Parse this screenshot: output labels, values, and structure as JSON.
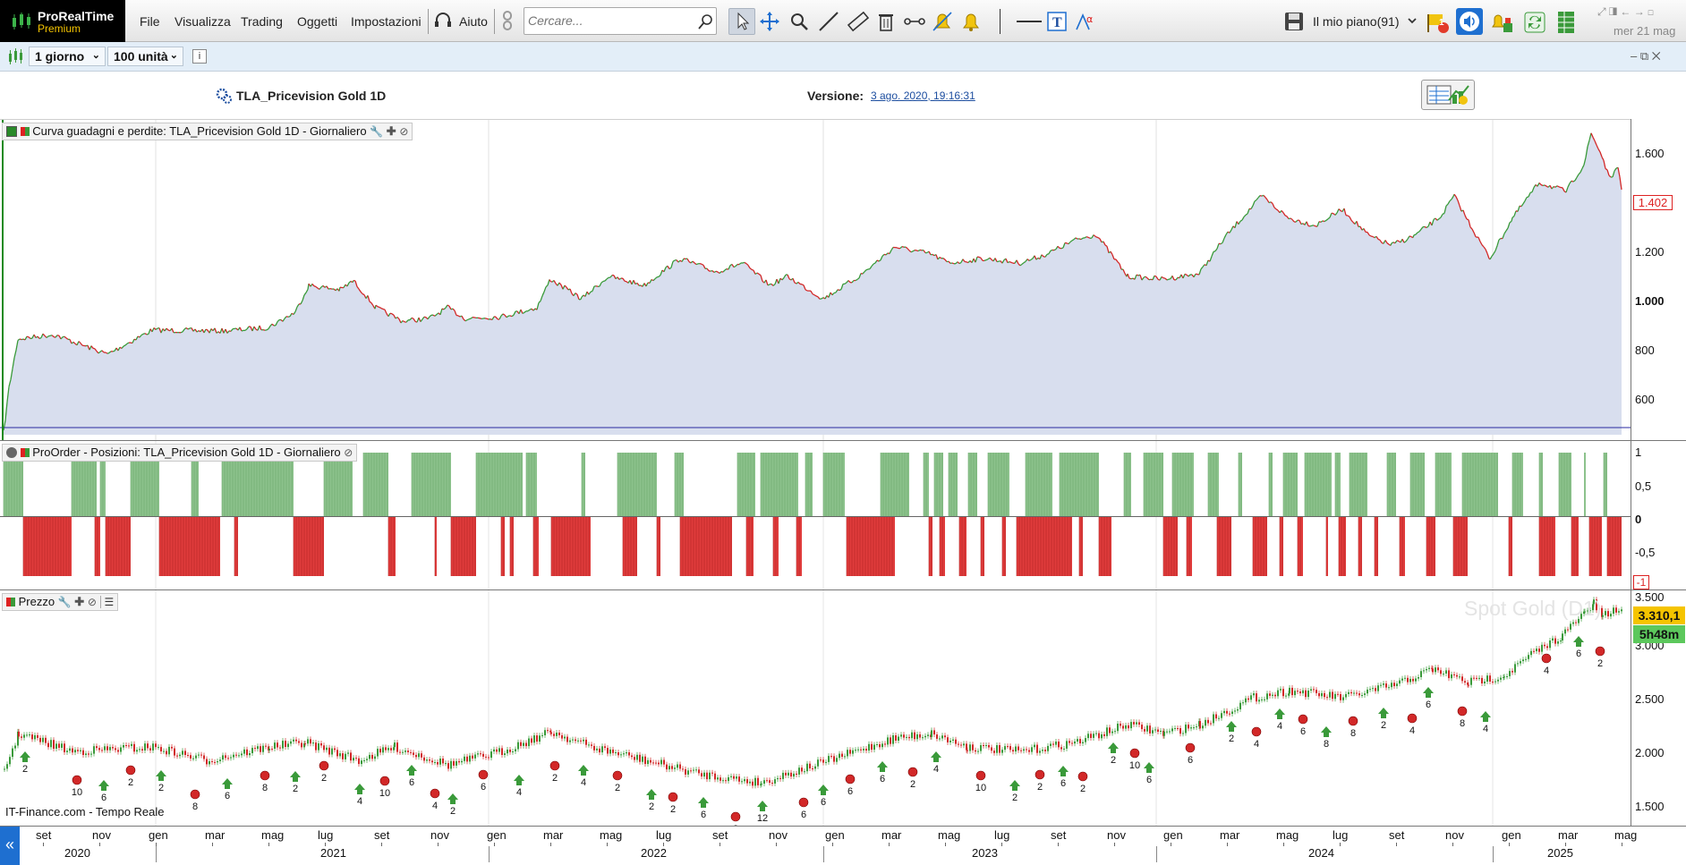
{
  "app": {
    "name": "ProRealTime",
    "edition": "Premium"
  },
  "menu": [
    "File",
    "Visualizza",
    "Trading",
    "Oggetti",
    "Impostazioni"
  ],
  "help_label": "Aiuto",
  "search": {
    "placeholder": "Cercare..."
  },
  "plan_label": "Il mio piano(91)",
  "alert_badge": "1",
  "date_label": "mer 21 mag",
  "toolbar2": {
    "timeframe": "1 giorno",
    "units": "100 unità"
  },
  "header": {
    "system_name": "TLA_Pricevision Gold 1D",
    "version_label": "Versione:",
    "version_date": "3 ago. 2020, 19:16:31"
  },
  "panels": {
    "equity": {
      "title": "Curva guadagni e perdite: TLA_Pricevision Gold 1D - Giornaliero",
      "yticks": [
        "1.600",
        "1.200",
        "1.000",
        "800",
        "600"
      ],
      "last_value": "1.402"
    },
    "positions": {
      "title": "ProOrder - Posizioni: TLA_Pricevision Gold 1D - Giornaliero",
      "yticks": [
        "1",
        "0,5",
        "0",
        "-0,5",
        "-1"
      ]
    },
    "price": {
      "title": "Prezzo",
      "watermark": "Spot Gold (D1)",
      "yticks": [
        "3.500",
        "3.000",
        "2.500",
        "2.000",
        "1.500"
      ],
      "last_price": "3.310,1",
      "countdown": "5h48m",
      "source": "IT-Finance.com - Tempo Reale"
    }
  },
  "trade_labels": [
    "2",
    "10",
    "6",
    "2",
    "2",
    "8",
    "6",
    "8",
    "2",
    "2",
    "4",
    "10",
    "6",
    "4",
    "2",
    "6",
    "4",
    "2",
    "4",
    "2",
    "2",
    "2",
    "6",
    "2",
    "12",
    "6",
    "6",
    "6",
    "6",
    "2",
    "4",
    "10",
    "2",
    "2",
    "6",
    "2",
    "2",
    "10",
    "6",
    "6",
    "2",
    "4",
    "4",
    "6",
    "8",
    "8",
    "2",
    "4",
    "6",
    "8",
    "4",
    "4",
    "6"
  ],
  "xaxis": {
    "months": [
      "set",
      "nov",
      "gen",
      "mar",
      "mag",
      "lug",
      "set",
      "nov",
      "gen",
      "mar",
      "mag",
      "lug",
      "set",
      "nov",
      "gen",
      "mar",
      "mag",
      "lug",
      "set",
      "nov",
      "gen",
      "mar",
      "mag",
      "lug",
      "set",
      "nov",
      "gen",
      "mar",
      "mag"
    ],
    "years": [
      "2020",
      "2021",
      "2022",
      "2023",
      "2024",
      "2025"
    ]
  },
  "colors": {
    "up": "#3a9a3a",
    "down": "#d22828",
    "equity_fill": "#d8deee",
    "long_bar": "#8cc28c",
    "short_bar": "#e03c3c",
    "accent": "#1e6fd0"
  }
}
